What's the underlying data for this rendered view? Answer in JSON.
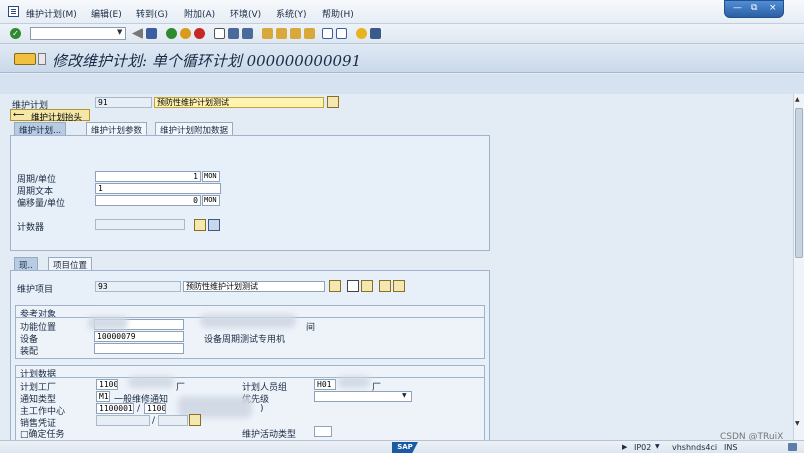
{
  "menubar": {
    "items": [
      "维护计划(M)",
      "编辑(E)",
      "转到(G)",
      "附加(A)",
      "环境(V)",
      "系统(Y)",
      "帮助(H)"
    ]
  },
  "window_controls": {
    "minimize": "—",
    "restore": "⧉",
    "close": "×"
  },
  "toolbar": {
    "command_field": "",
    "icons": [
      "back-icon",
      "save-icon",
      "nav-back-icon",
      "exit-icon",
      "cancel-icon",
      "print-icon",
      "find-icon",
      "find-next-icon",
      "first-page-icon",
      "prev-page-icon",
      "next-page-icon",
      "last-page-icon",
      "new-session-icon",
      "shortcut-icon",
      "help-icon",
      "layout-icon"
    ]
  },
  "title": "修改维护计划: 单个循环计划 000000000091",
  "header": {
    "plan_label": "维护计划",
    "plan_number": "91",
    "plan_description": "预防性维护计划测试",
    "header_button": "维护计划抬头"
  },
  "tabs_top": [
    "维护计划...",
    "维护计划参数",
    "维护计划附加数据"
  ],
  "cycle": {
    "cycle_unit_label": "周期/单位",
    "cycle_value": "1",
    "cycle_unit": "MON",
    "cycle_text_label": "周期文本",
    "cycle_text": "1",
    "offset_label": "偏移量/单位",
    "offset_value": "0",
    "offset_unit": "MON",
    "counter_label": "计数器"
  },
  "tabs_bottom": [
    "现..",
    "项目位置"
  ],
  "item": {
    "item_label": "维护项目",
    "item_number": "93",
    "item_description": "预防性维护计划测试"
  },
  "reference_object": {
    "title": "参考对象",
    "func_loc_label": "功能位置",
    "func_loc_value": "",
    "func_loc_suffix": "间",
    "equipment_label": "设备",
    "equipment_value": "10000079",
    "equipment_desc": "设备周期测试专用机",
    "assembly_label": "装配",
    "assembly_value": ""
  },
  "planning_data": {
    "title": "计划数据",
    "plant_label": "计划工厂",
    "plant_value": "1100",
    "plant_suffix": "厂",
    "planner_group_label": "计划人员组",
    "planner_group_value": "H01",
    "planner_group_suffix": "厂",
    "notif_type_label": "通知类型",
    "notif_type_value": "M1",
    "notif_type_desc": "一般维修通知",
    "priority_label": "优先级",
    "priority_value": "",
    "work_center_label": "主工作中心",
    "work_center_value": "11000010",
    "work_center_plant": "1100",
    "work_center_suffix": ")",
    "sales_doc_label": "销售凭证",
    "sales_doc_value": "",
    "sales_doc_item": "",
    "confirm_task_label": "□确定任务",
    "activity_type_label": "维护活动类型",
    "activity_type_value": ""
  },
  "status_bar": {
    "sap_logo": "SAP",
    "system": "IP02",
    "server": "vhshnds4ci",
    "mode": "INS"
  },
  "watermark": "CSDN @TRuiX"
}
